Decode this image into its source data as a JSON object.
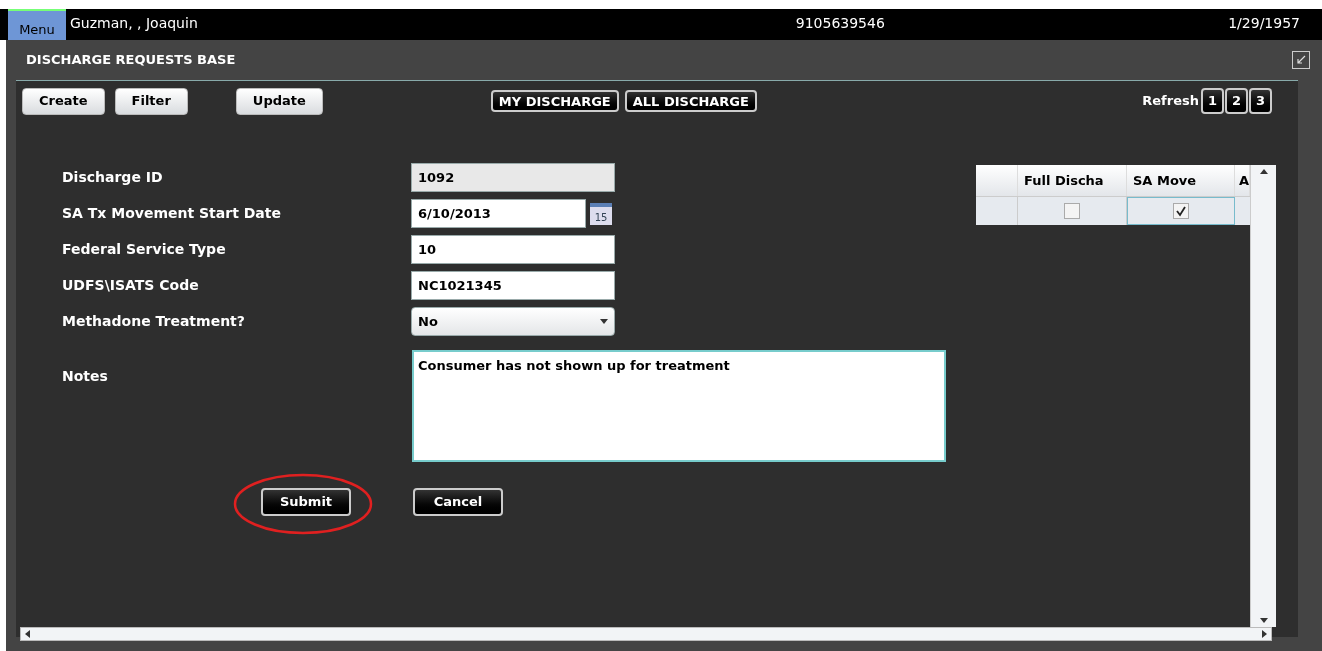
{
  "header": {
    "menu": "Menu",
    "patient_name": "Guzman,  , Joaquin",
    "phone": "9105639546",
    "birth_date": "1/29/1957"
  },
  "panel": {
    "title": "DISCHARGE REQUESTS BASE"
  },
  "toolbar": {
    "buttons": [
      "Create",
      "Filter",
      "Update"
    ],
    "tabs": [
      "MY DISCHARGE",
      "ALL DISCHARGE"
    ],
    "refresh_label": "Refresh",
    "pages": [
      "1",
      "2",
      "3"
    ]
  },
  "form": {
    "fields": [
      {
        "kind": "readonly",
        "label": "Discharge ID",
        "value": "1092"
      },
      {
        "kind": "date",
        "label": "SA Tx Movement Start Date",
        "value": "6/10/2013",
        "calendar_day": "15"
      },
      {
        "kind": "text",
        "label": "Federal Service Type",
        "value": "10"
      },
      {
        "kind": "text",
        "label": "UDFS\\ISATS Code",
        "value": "NC1021345"
      },
      {
        "kind": "select",
        "label": "Methadone Treatment?",
        "value": "No"
      }
    ],
    "notes": {
      "label": "Notes",
      "value": "Consumer has not shown up for treatment"
    },
    "submit": {
      "label": "Submit",
      "circled": true
    },
    "cancel": {
      "label": "Cancel"
    }
  },
  "grid": {
    "columns": [
      "",
      "Full Discha",
      "SA Move",
      "A"
    ],
    "rows": [
      {
        "full_discharge": false,
        "sa_move": true
      }
    ]
  }
}
